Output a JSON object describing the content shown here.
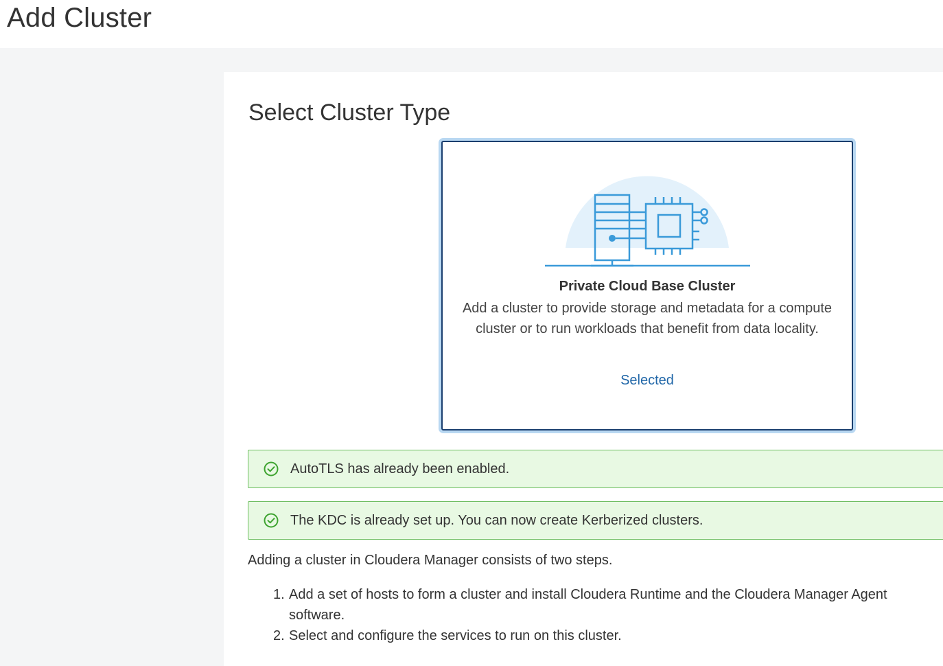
{
  "page": {
    "title": "Add Cluster"
  },
  "section": {
    "title": "Select Cluster Type"
  },
  "cluster_card": {
    "illustration_icon": "server-and-chip-icon",
    "name": "Private Cloud Base Cluster",
    "description": "Add a cluster to provide storage and metadata for a compute cluster or to run workloads that benefit from data locality.",
    "status": "Selected"
  },
  "alerts": [
    {
      "icon": "check-circle-icon",
      "message": "AutoTLS has already been enabled."
    },
    {
      "icon": "check-circle-icon",
      "message": "The KDC is already set up. You can now create Kerberized clusters."
    }
  ],
  "info": {
    "intro": "Adding a cluster in Cloudera Manager consists of two steps.",
    "steps": [
      {
        "num": "1.",
        "text": "Add a set of hosts to form a cluster and install Cloudera Runtime and the Cloudera Manager Agent software."
      },
      {
        "num": "2.",
        "text": "Select and configure the services to run on this cluster."
      }
    ]
  },
  "colors": {
    "accent": "#2167a8",
    "card_border": "#1a3e6e",
    "success_bg": "#e8f9e3",
    "success_border": "#6cbd5f",
    "success_icon": "#3da32f"
  }
}
